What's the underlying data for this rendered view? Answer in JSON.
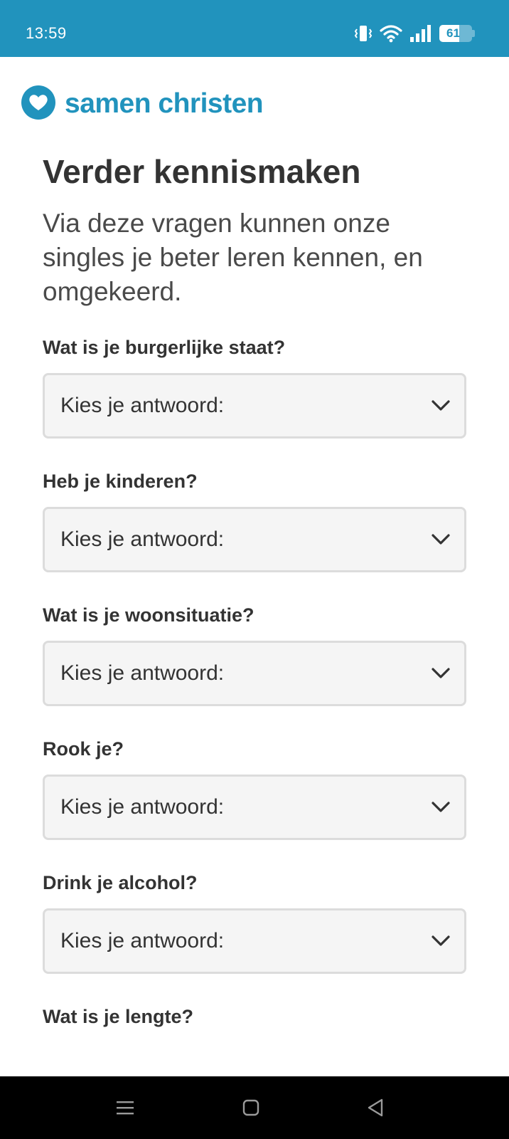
{
  "status_bar": {
    "time": "13:59",
    "battery_level": "61",
    "battery_percent": 61,
    "icons": [
      "vibrate-icon",
      "wifi-icon",
      "signal-icon",
      "battery-icon"
    ]
  },
  "brand": {
    "name": "samen christen",
    "color": "#2193bd"
  },
  "page": {
    "title": "Verder kennismaken",
    "intro": "Via deze vragen kunnen onze singles je beter leren kennen, en omgekeerd."
  },
  "questions": [
    {
      "label": "Wat is je burgerlijke staat?",
      "value": "Kies je antwoord:"
    },
    {
      "label": "Heb je kinderen?",
      "value": "Kies je antwoord:"
    },
    {
      "label": "Wat is je woonsituatie?",
      "value": "Kies je antwoord:"
    },
    {
      "label": "Rook je?",
      "value": "Kies je antwoord:"
    },
    {
      "label": "Drink je alcohol?",
      "value": "Kies je antwoord:"
    },
    {
      "label": "Wat is je lengte?"
    }
  ],
  "nav_bar": {
    "icons": [
      "menu-icon",
      "home-icon",
      "back-icon"
    ]
  }
}
